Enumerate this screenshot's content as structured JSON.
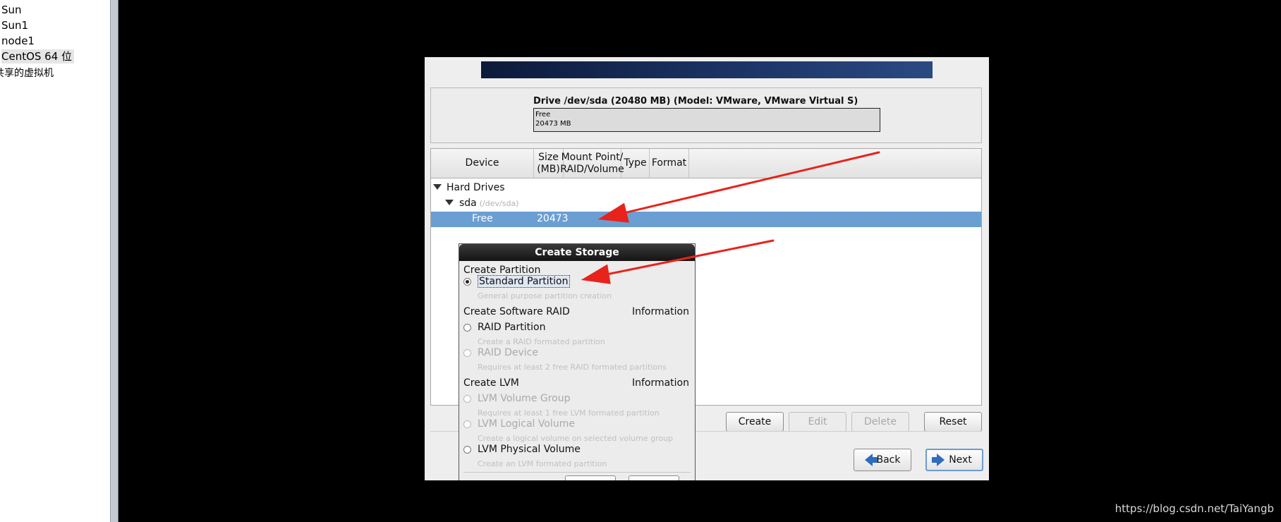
{
  "sidebar": {
    "vms": [
      "Sun",
      "Sun1",
      "node1",
      "CentOS 64 位"
    ],
    "shared_label": "共享的虚拟机"
  },
  "drive": {
    "title": "Drive /dev/sda (20480 MB) (Model: VMware, VMware Virtual S)",
    "free_label": "Free",
    "free_size": "20473 MB"
  },
  "table": {
    "columns": [
      "Device",
      "Size\n(MB)",
      "Mount Point/\nRAID/Volume",
      "Type",
      "Format"
    ],
    "rows": {
      "hard_drives": "Hard Drives",
      "sda": "sda",
      "sda_path": "(/dev/sda)",
      "free_device": "Free",
      "free_size": "20473"
    }
  },
  "buttons": {
    "create": "Create",
    "edit": "Edit",
    "delete": "Delete",
    "reset": "Reset",
    "back": "Back",
    "next": "Next"
  },
  "dialog": {
    "title": "Create Storage",
    "sections": {
      "partition": "Create Partition",
      "raid": "Create Software RAID",
      "lvm": "Create LVM",
      "info": "Information"
    },
    "options": {
      "standard": "Standard Partition",
      "standard_desc": "General purpose partition creation",
      "raid_partition": "RAID Partition",
      "raid_partition_desc": "Create a RAID formated partition",
      "raid_device": "RAID Device",
      "raid_device_desc": "Requires at least 2 free RAID formated partitions",
      "lvm_vg": "LVM Volume Group",
      "lvm_vg_desc": "Requires at least 1 free LVM formated partition",
      "lvm_lv": "LVM Logical Volume",
      "lvm_lv_desc": "Create a logical volume on selected volume group",
      "lvm_pv": "LVM Physical Volume",
      "lvm_pv_desc": "Create an LVM formated partition"
    },
    "selected": "Standard Partition"
  },
  "watermark": "https://blog.csdn.net/TaiYangb",
  "colors": {
    "selection": "#6b9fd4",
    "annotation_arrow": "#e8231c"
  }
}
